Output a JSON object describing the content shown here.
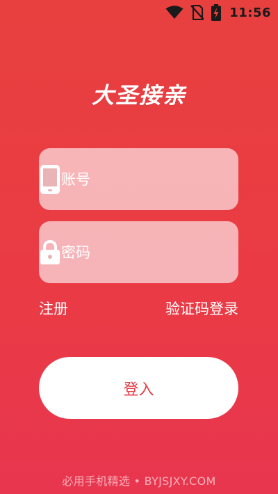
{
  "status_bar": {
    "time": "11:56",
    "icons": [
      "wifi-icon",
      "no-sim-icon",
      "battery-charging-icon"
    ]
  },
  "app": {
    "title": "大圣接亲"
  },
  "form": {
    "account_placeholder": "账号",
    "password_placeholder": "密码",
    "account_icon": "phone-icon",
    "password_icon": "lock-icon"
  },
  "links": {
    "register": "注册",
    "sms_login": "验证码登录"
  },
  "login_button": {
    "label": "登入"
  },
  "watermark": {
    "text": "必用手机精选 • BYJSJXY.COM"
  },
  "colors": {
    "background_top": "#e8403f",
    "background_bottom": "#e8364f",
    "accent_text": "#e43f4a",
    "field_fill": "rgba(255,255,255,0.62)"
  }
}
